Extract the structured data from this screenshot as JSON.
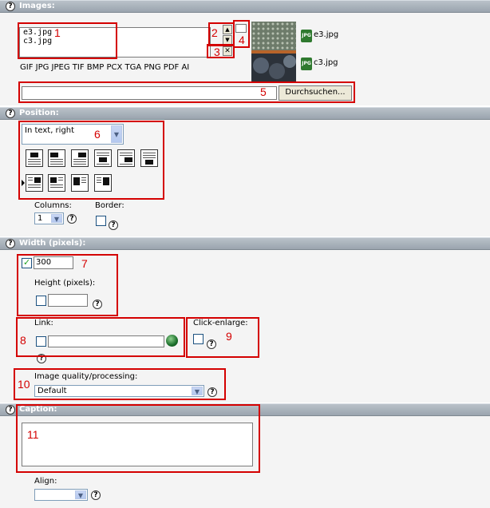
{
  "sections": {
    "images": "Images:",
    "position": "Position:",
    "width": "Width (pixels):",
    "caption": "Caption:"
  },
  "images": {
    "files": [
      "e3.jpg",
      "c3.jpg"
    ],
    "formats": "GIF JPG JPEG TIF BMP PCX TGA PNG PDF AI",
    "thumb_labels": [
      "e3.jpg",
      "c3.jpg"
    ],
    "thumb_icon": "JPG",
    "browse_label": "Durchsuchen..."
  },
  "position": {
    "selected": "In text, right",
    "columns_label": "Columns:",
    "columns_value": "1",
    "border_label": "Border:"
  },
  "width": {
    "value": "300",
    "height_label": "Height (pixels):",
    "link_label": "Link:",
    "click_enlarge_label": "Click-enlarge:",
    "quality_label": "Image quality/processing:",
    "quality_value": "Default"
  },
  "caption": {
    "align_label": "Align:"
  },
  "annotations": [
    "1",
    "2",
    "3",
    "4",
    "5",
    "6",
    "7",
    "8",
    "9",
    "10",
    "11"
  ],
  "icons": {
    "help": "?",
    "up": "▲",
    "down": "▼",
    "remove": "✕",
    "dropdown": "▼"
  },
  "colors": {
    "highlight": "#d40000",
    "header": "#9aa4ae",
    "section_bg": "#f4f4f4"
  }
}
